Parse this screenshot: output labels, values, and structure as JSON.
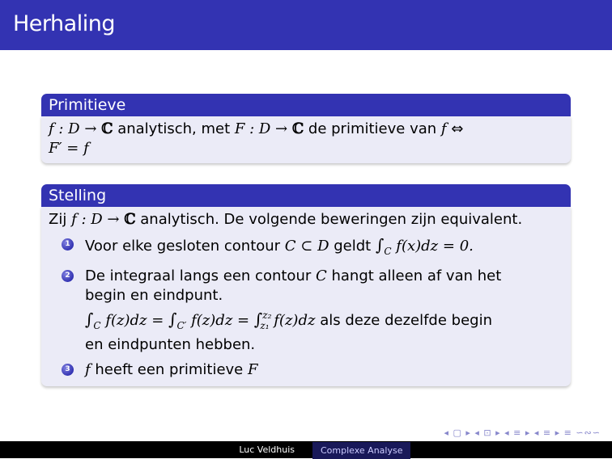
{
  "slide": {
    "title": "Herhaling"
  },
  "primitieve_block": {
    "title": "Primitieve",
    "line1_a": "f : D → ",
    "line1_b": "ℂ",
    "line1_c": " analytisch, met ",
    "line1_d": "F : D → ",
    "line1_e": "ℂ",
    "line1_f": " de primitieve van ",
    "line1_g": "f",
    "line1_h": " ⇔",
    "line2": "F′ = f"
  },
  "stelling_block": {
    "title": "Stelling",
    "intro_a": "Zij ",
    "intro_b": "f : D → ",
    "intro_c": "ℂ",
    "intro_d": " analytisch. De volgende beweringen zijn equivalent.",
    "items": [
      {
        "number": "1",
        "text_a": "Voor elke gesloten contour ",
        "text_b": "C ⊂ D",
        "text_c": " geldt ",
        "text_d": "∫",
        "text_e": "C",
        "text_f": " f(x)dz = 0.",
        "text_g": ""
      },
      {
        "number": "2",
        "line1": "De integraal langs een contour ",
        "line1_var": "C",
        "line1_end": " hangt alleen af van het",
        "line2": "begin en eindpunt.",
        "eq_int1": "∫",
        "eq_sub1": "C",
        "eq_part1": " f(z)dz = ",
        "eq_int2": "∫",
        "eq_sub2": "C′",
        "eq_part2": " f(z)dz = ",
        "eq_int3": "∫",
        "eq_sup3": "z₂",
        "eq_sub3": "z₁",
        "eq_part3": " f(z)dz",
        "eq_tail": " als deze dezelfde begin",
        "line4": "en eindpunten hebben."
      },
      {
        "number": "3",
        "text_a": "f",
        "text_b": " heeft een primitieve ",
        "text_c": "F"
      }
    ]
  },
  "navigation": {
    "symbols": "◂ ▢ ▸ ◂ ⊡ ▸ ◂ ≡ ▸ ◂ ≡ ▸ ≡ ∽∾∽"
  },
  "footer": {
    "author": "Luc Veldhuis",
    "course": "Complexe Analyse"
  }
}
